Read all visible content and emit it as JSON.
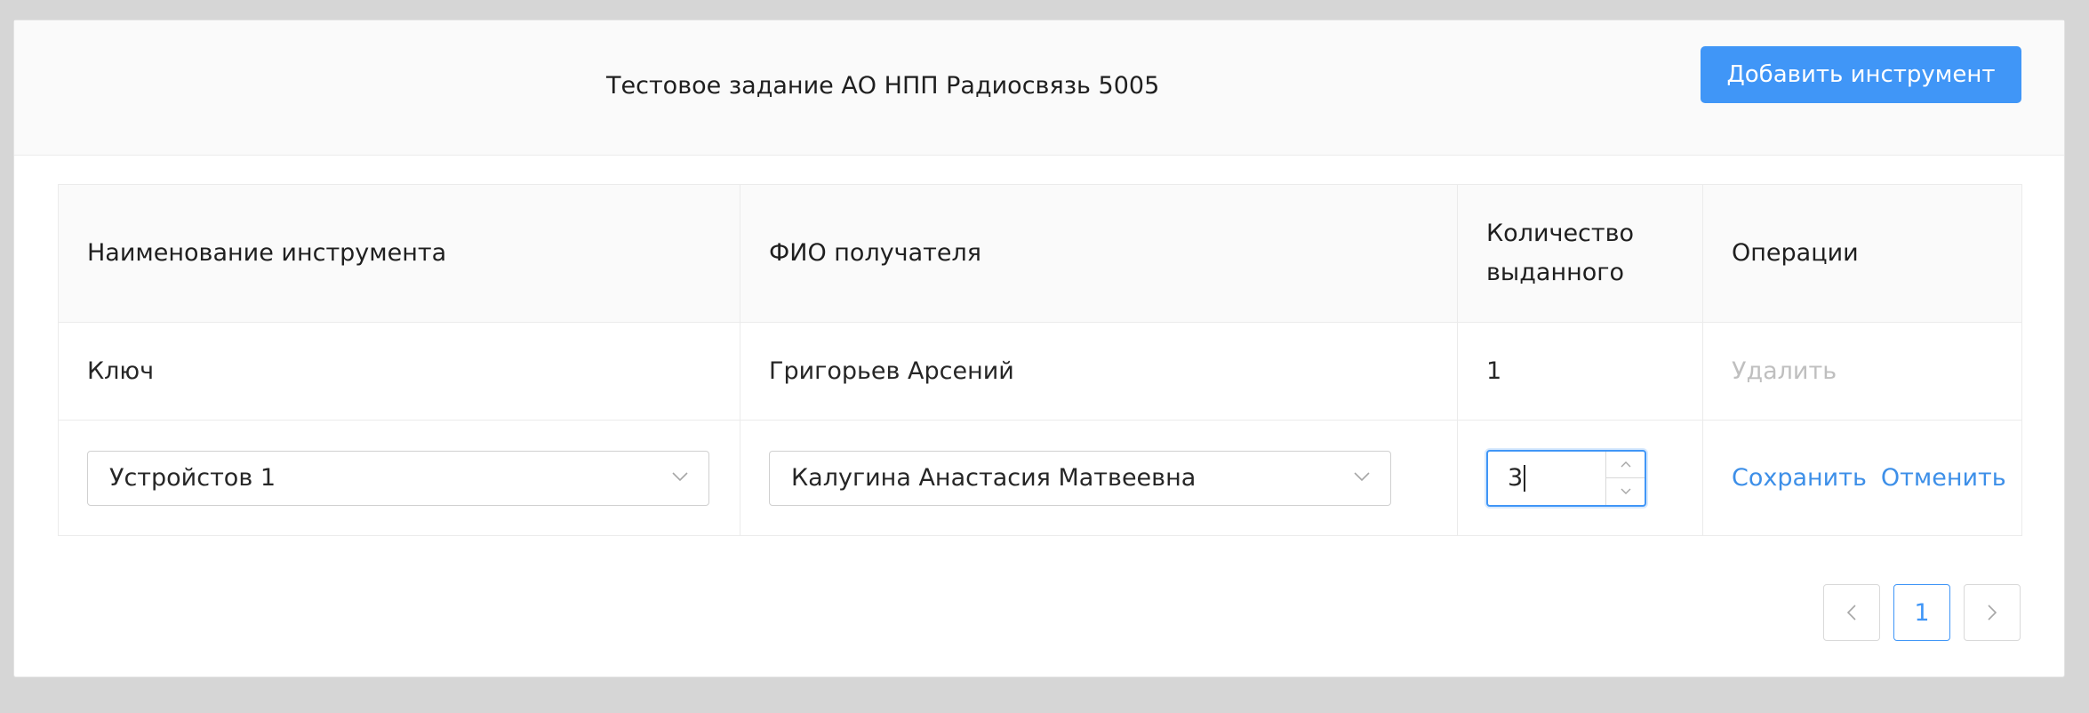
{
  "header": {
    "title": "Тестовое задание АО НПП Радиосвязь 5005",
    "add_button": "Добавить инструмент"
  },
  "table": {
    "columns": [
      "Наименование инструмента",
      "ФИО получателя",
      "Количество выданного",
      "Операции"
    ],
    "rows": [
      {
        "tool": "Ключ",
        "recipient": "Григорьев Арсений",
        "quantity": "1",
        "delete_label": "Удалить"
      }
    ],
    "edit_row": {
      "tool_select_value": "Устройстов 1",
      "recipient_select_value": "Калугина Анастасия Матвеевна",
      "quantity_value": "3",
      "save_label": "Сохранить",
      "cancel_label": "Отменить"
    }
  },
  "pagination": {
    "current_page": "1"
  },
  "colors": {
    "primary": "#4096f7",
    "link": "#3d8fe8",
    "disabled_text": "#bfbfbf",
    "page_background": "#d6d6d6"
  }
}
